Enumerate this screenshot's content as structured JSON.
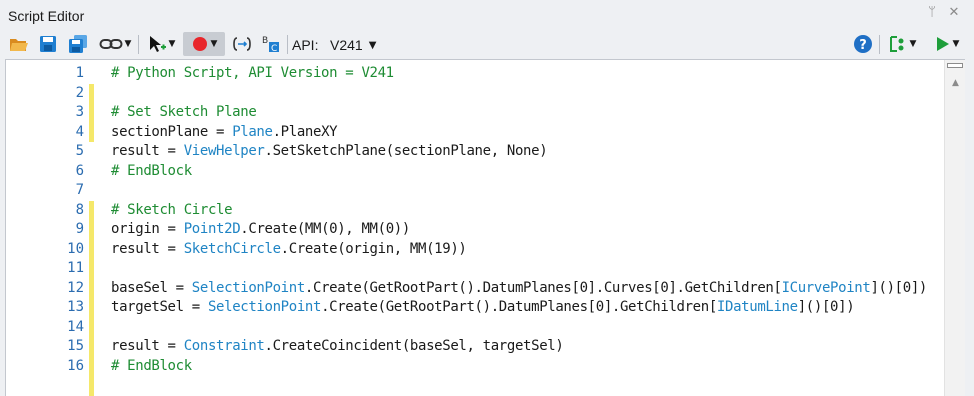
{
  "window": {
    "title": "Script Editor",
    "pin_glyph": "ᛘ",
    "close_glyph": "✕"
  },
  "toolbar": {
    "api_label": "API:",
    "api_version": "V241",
    "icons": [
      "open-folder-icon",
      "save-icon",
      "save-as-icon",
      "link-icon",
      "select-tool-icon",
      "record-icon",
      "bracket-icon",
      "variable-icon",
      "help-icon",
      "run-options-icon",
      "run-icon"
    ]
  },
  "colors": {
    "comment": "#1e8c33",
    "type": "#1f84c4",
    "line_number": "#2b6cb0",
    "change_marker": "#f5e86a",
    "record": "#e8262b",
    "run": "#1e9e3a"
  },
  "editor": {
    "lines": [
      {
        "num": "1",
        "parts": [
          {
            "t": "# Python Script, API Version = V241",
            "k": "comment"
          }
        ]
      },
      {
        "num": "2",
        "parts": []
      },
      {
        "num": "3",
        "parts": [
          {
            "t": "# Set Sketch Plane",
            "k": "comment"
          }
        ]
      },
      {
        "num": "4",
        "parts": [
          {
            "t": "sectionPlane = ",
            "k": "plain"
          },
          {
            "t": "Plane",
            "k": "type"
          },
          {
            "t": ".PlaneXY",
            "k": "plain"
          }
        ]
      },
      {
        "num": "5",
        "parts": [
          {
            "t": "result = ",
            "k": "plain"
          },
          {
            "t": "ViewHelper",
            "k": "type"
          },
          {
            "t": ".SetSketchPlane(sectionPlane, None)",
            "k": "plain"
          }
        ]
      },
      {
        "num": "6",
        "parts": [
          {
            "t": "# EndBlock",
            "k": "comment"
          }
        ]
      },
      {
        "num": "7",
        "parts": []
      },
      {
        "num": "8",
        "parts": [
          {
            "t": "# Sketch Circle",
            "k": "comment"
          }
        ]
      },
      {
        "num": "9",
        "parts": [
          {
            "t": "origin = ",
            "k": "plain"
          },
          {
            "t": "Point2D",
            "k": "type"
          },
          {
            "t": ".Create(MM(0), MM(0))",
            "k": "plain"
          }
        ]
      },
      {
        "num": "10",
        "parts": [
          {
            "t": "result = ",
            "k": "plain"
          },
          {
            "t": "SketchCircle",
            "k": "type"
          },
          {
            "t": ".Create(origin, MM(19))",
            "k": "plain"
          }
        ]
      },
      {
        "num": "11",
        "parts": []
      },
      {
        "num": "12",
        "parts": [
          {
            "t": "baseSel = ",
            "k": "plain"
          },
          {
            "t": "SelectionPoint",
            "k": "type"
          },
          {
            "t": ".Create(GetRootPart().DatumPlanes[0].Curves[0].GetChildren[",
            "k": "plain"
          },
          {
            "t": "ICurvePoint",
            "k": "type"
          },
          {
            "t": "]()[0])",
            "k": "plain"
          }
        ]
      },
      {
        "num": "13",
        "parts": [
          {
            "t": "targetSel = ",
            "k": "plain"
          },
          {
            "t": "SelectionPoint",
            "k": "type"
          },
          {
            "t": ".Create(GetRootPart().DatumPlanes[0].GetChildren[",
            "k": "plain"
          },
          {
            "t": "IDatumLine",
            "k": "type"
          },
          {
            "t": "]()[0])",
            "k": "plain"
          }
        ]
      },
      {
        "num": "14",
        "parts": []
      },
      {
        "num": "15",
        "parts": [
          {
            "t": "result = ",
            "k": "plain"
          },
          {
            "t": "Constraint",
            "k": "type"
          },
          {
            "t": ".CreateCoincident(baseSel, targetSel)",
            "k": "plain"
          }
        ]
      },
      {
        "num": "16",
        "parts": [
          {
            "t": "# EndBlock",
            "k": "comment"
          }
        ]
      }
    ]
  }
}
